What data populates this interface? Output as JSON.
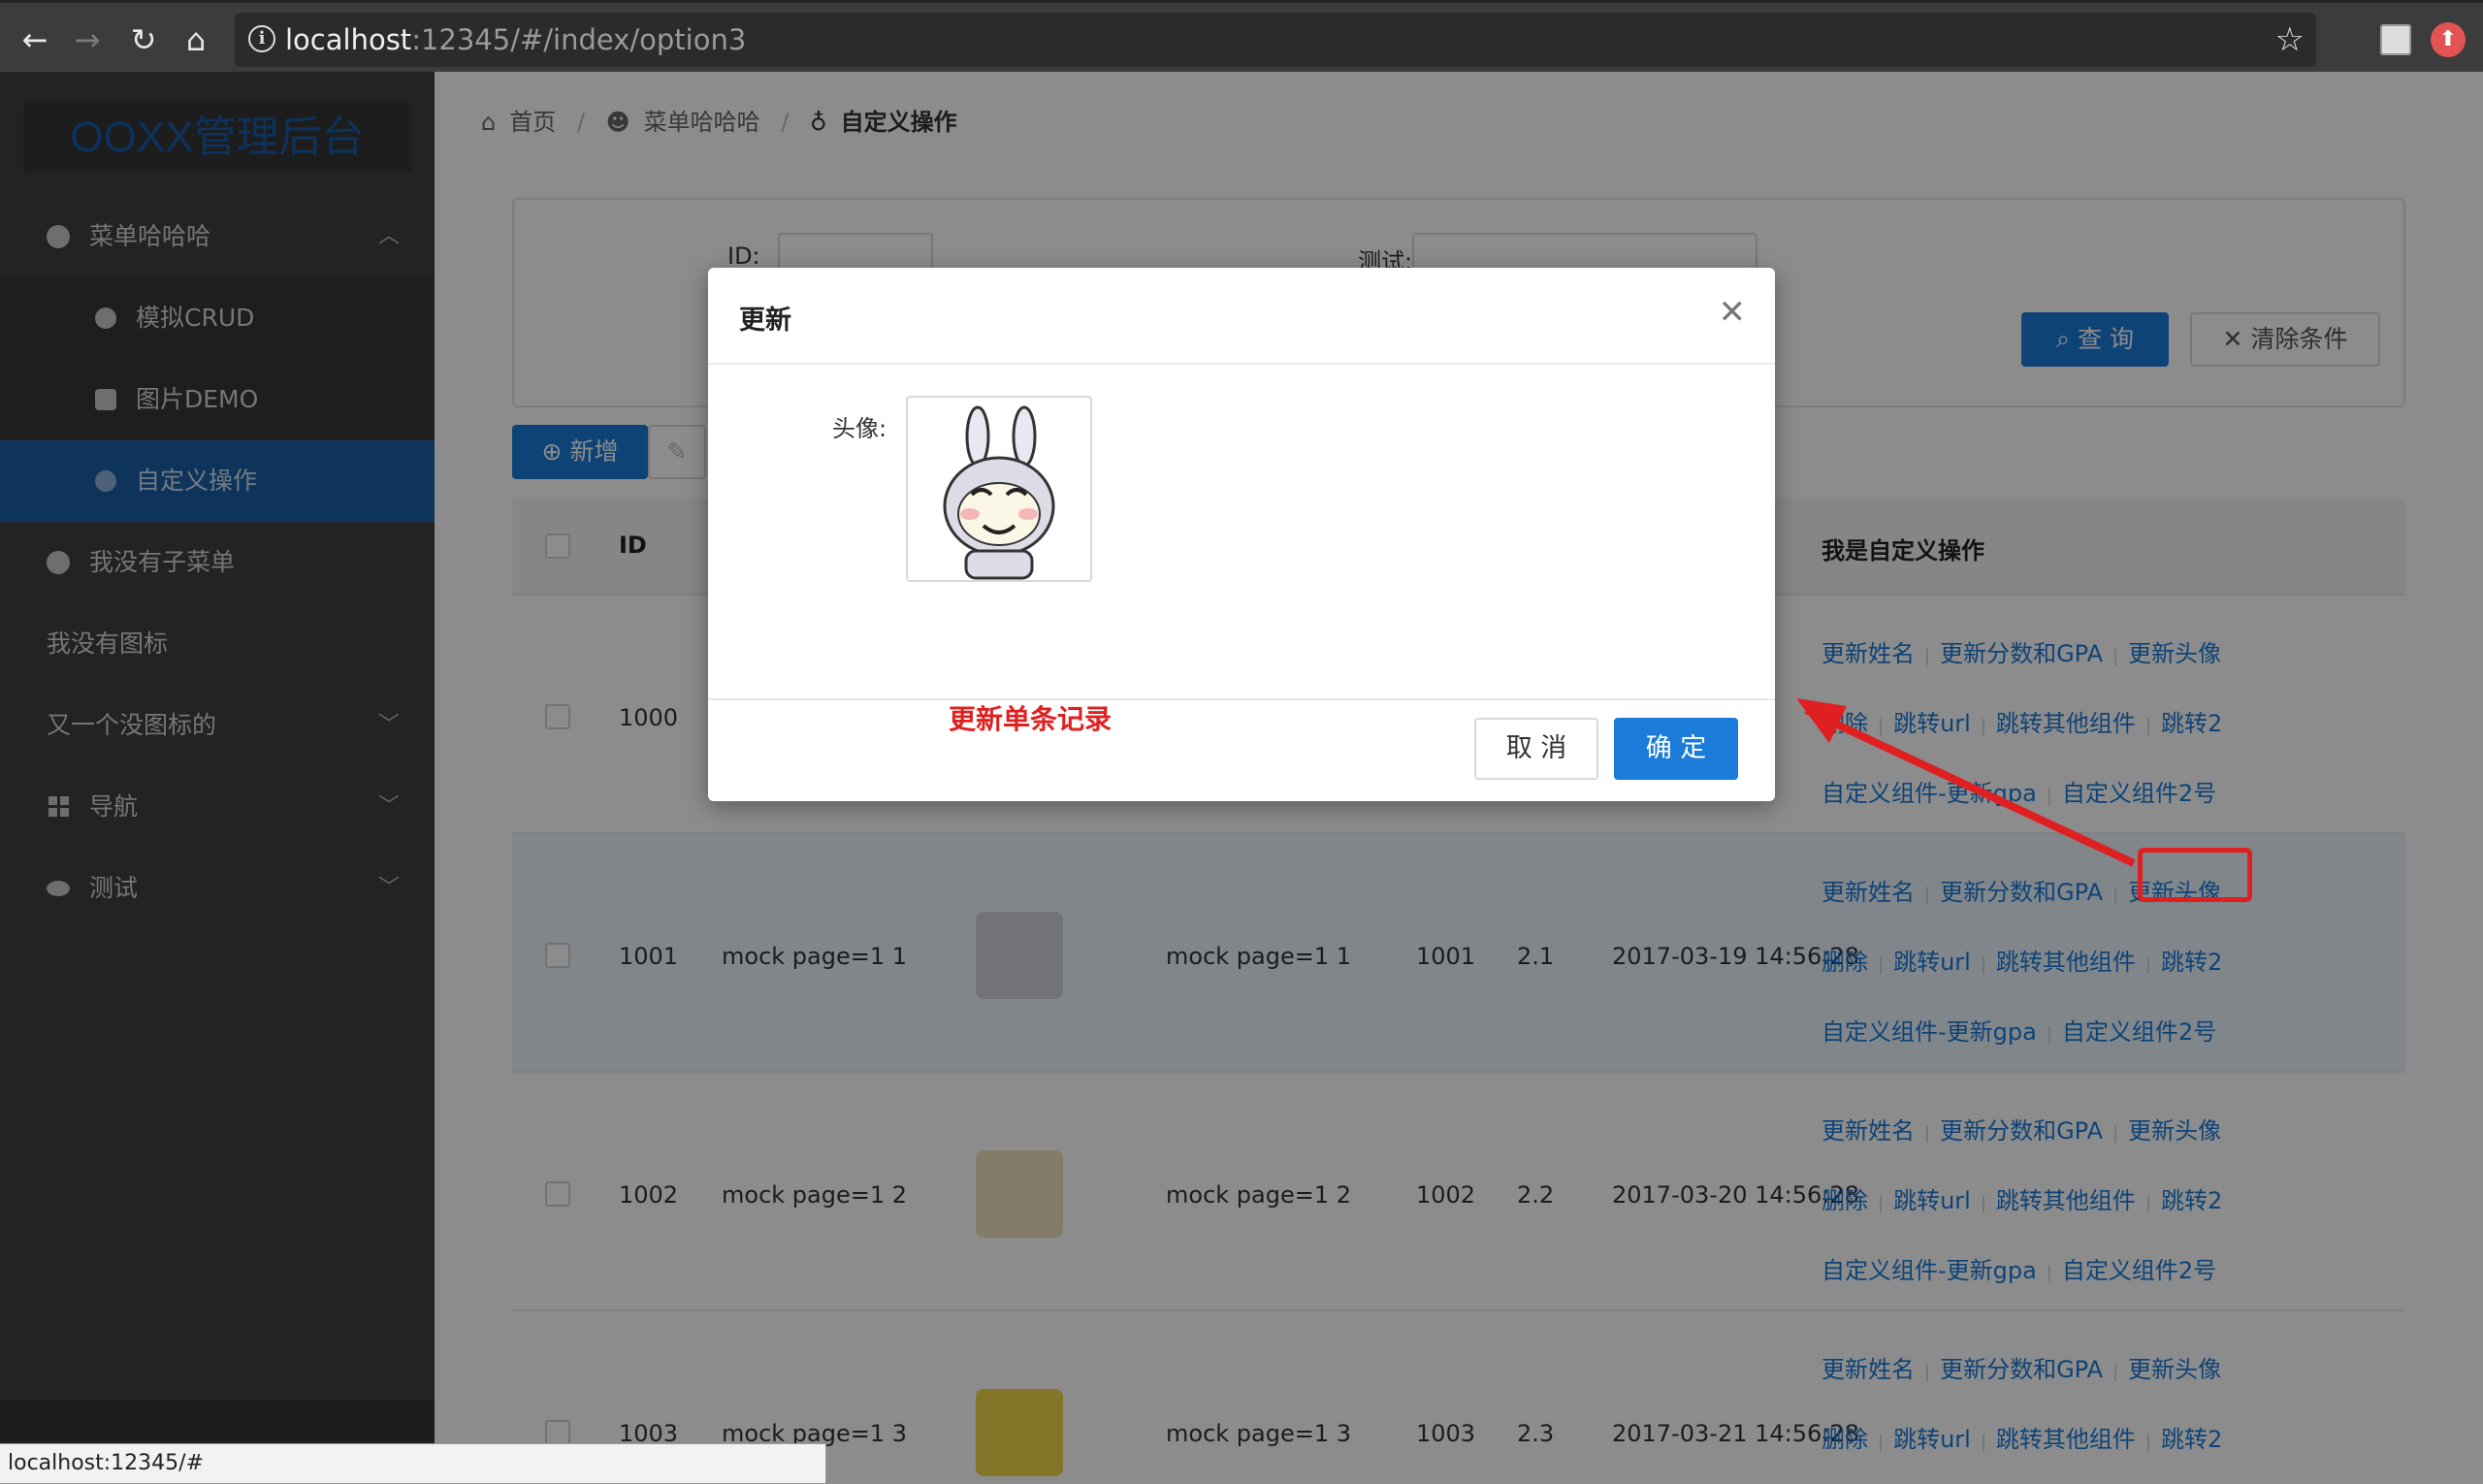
{
  "browser": {
    "url_host": "localhost",
    "url_rest": ":12345/#/index/option3",
    "status_url": "localhost:12345/#"
  },
  "sidebar": {
    "logo": "OOXX管理后台",
    "items": [
      {
        "label": "菜单哈哈哈",
        "icon": "smile-icon",
        "arrow": "︿"
      },
      {
        "label": "模拟CRUD",
        "icon": "play-circle-icon"
      },
      {
        "label": "图片DEMO",
        "icon": "android-icon"
      },
      {
        "label": "自定义操作",
        "icon": "bulb-icon"
      },
      {
        "label": "我没有子菜单",
        "icon": "clock-icon"
      },
      {
        "label": "我没有图标"
      },
      {
        "label": "又一个没图标的",
        "arrow": "﹀"
      },
      {
        "label": "导航",
        "icon": "appstore-icon",
        "arrow": "﹀"
      },
      {
        "label": "测试",
        "icon": "eye-icon",
        "arrow": "﹀"
      }
    ]
  },
  "breadcrumb": {
    "home": "首页",
    "menu": "菜单哈哈哈",
    "current": "自定义操作"
  },
  "search": {
    "id_label": "ID:",
    "test_label": "测试:",
    "query_button": "查 询",
    "clear_button": "清除条件"
  },
  "toolbar": {
    "add_button": "新增"
  },
  "table": {
    "headers": {
      "id": "ID",
      "ops": "我是自定义操作"
    },
    "ops": {
      "line1": [
        "更新姓名",
        "更新分数和GPA",
        "更新头像"
      ],
      "line2": [
        "删除",
        "跳转url",
        "跳转其他组件",
        "跳转2"
      ],
      "line3": [
        "自定义组件-更新gpa",
        "自定义组件2号"
      ]
    },
    "rows": [
      {
        "id": "1000",
        "name": "",
        "nick": "",
        "num": "",
        "gpa": "",
        "time": ""
      },
      {
        "id": "1001",
        "name": "mock page=1 1",
        "nick": "mock page=1 1",
        "num": "1001",
        "gpa": "2.1",
        "time": "2017-03-19 14:56:28"
      },
      {
        "id": "1002",
        "name": "mock page=1 2",
        "nick": "mock page=1 2",
        "num": "1002",
        "gpa": "2.2",
        "time": "2017-03-20 14:56:28"
      },
      {
        "id": "1003",
        "name": "mock page=1 3",
        "nick": "mock page=1 3",
        "num": "1003",
        "gpa": "2.3",
        "time": "2017-03-21 14:56:28"
      }
    ]
  },
  "modal": {
    "title": "更新",
    "field_label": "头像:",
    "cancel": "取 消",
    "ok": "确 定",
    "annotation": "更新单条记录"
  },
  "colors": {
    "primary": "#1a7bd9",
    "sidebar": "#404040",
    "active_menu": "#1d5fa6",
    "annotation": "#e02020"
  }
}
